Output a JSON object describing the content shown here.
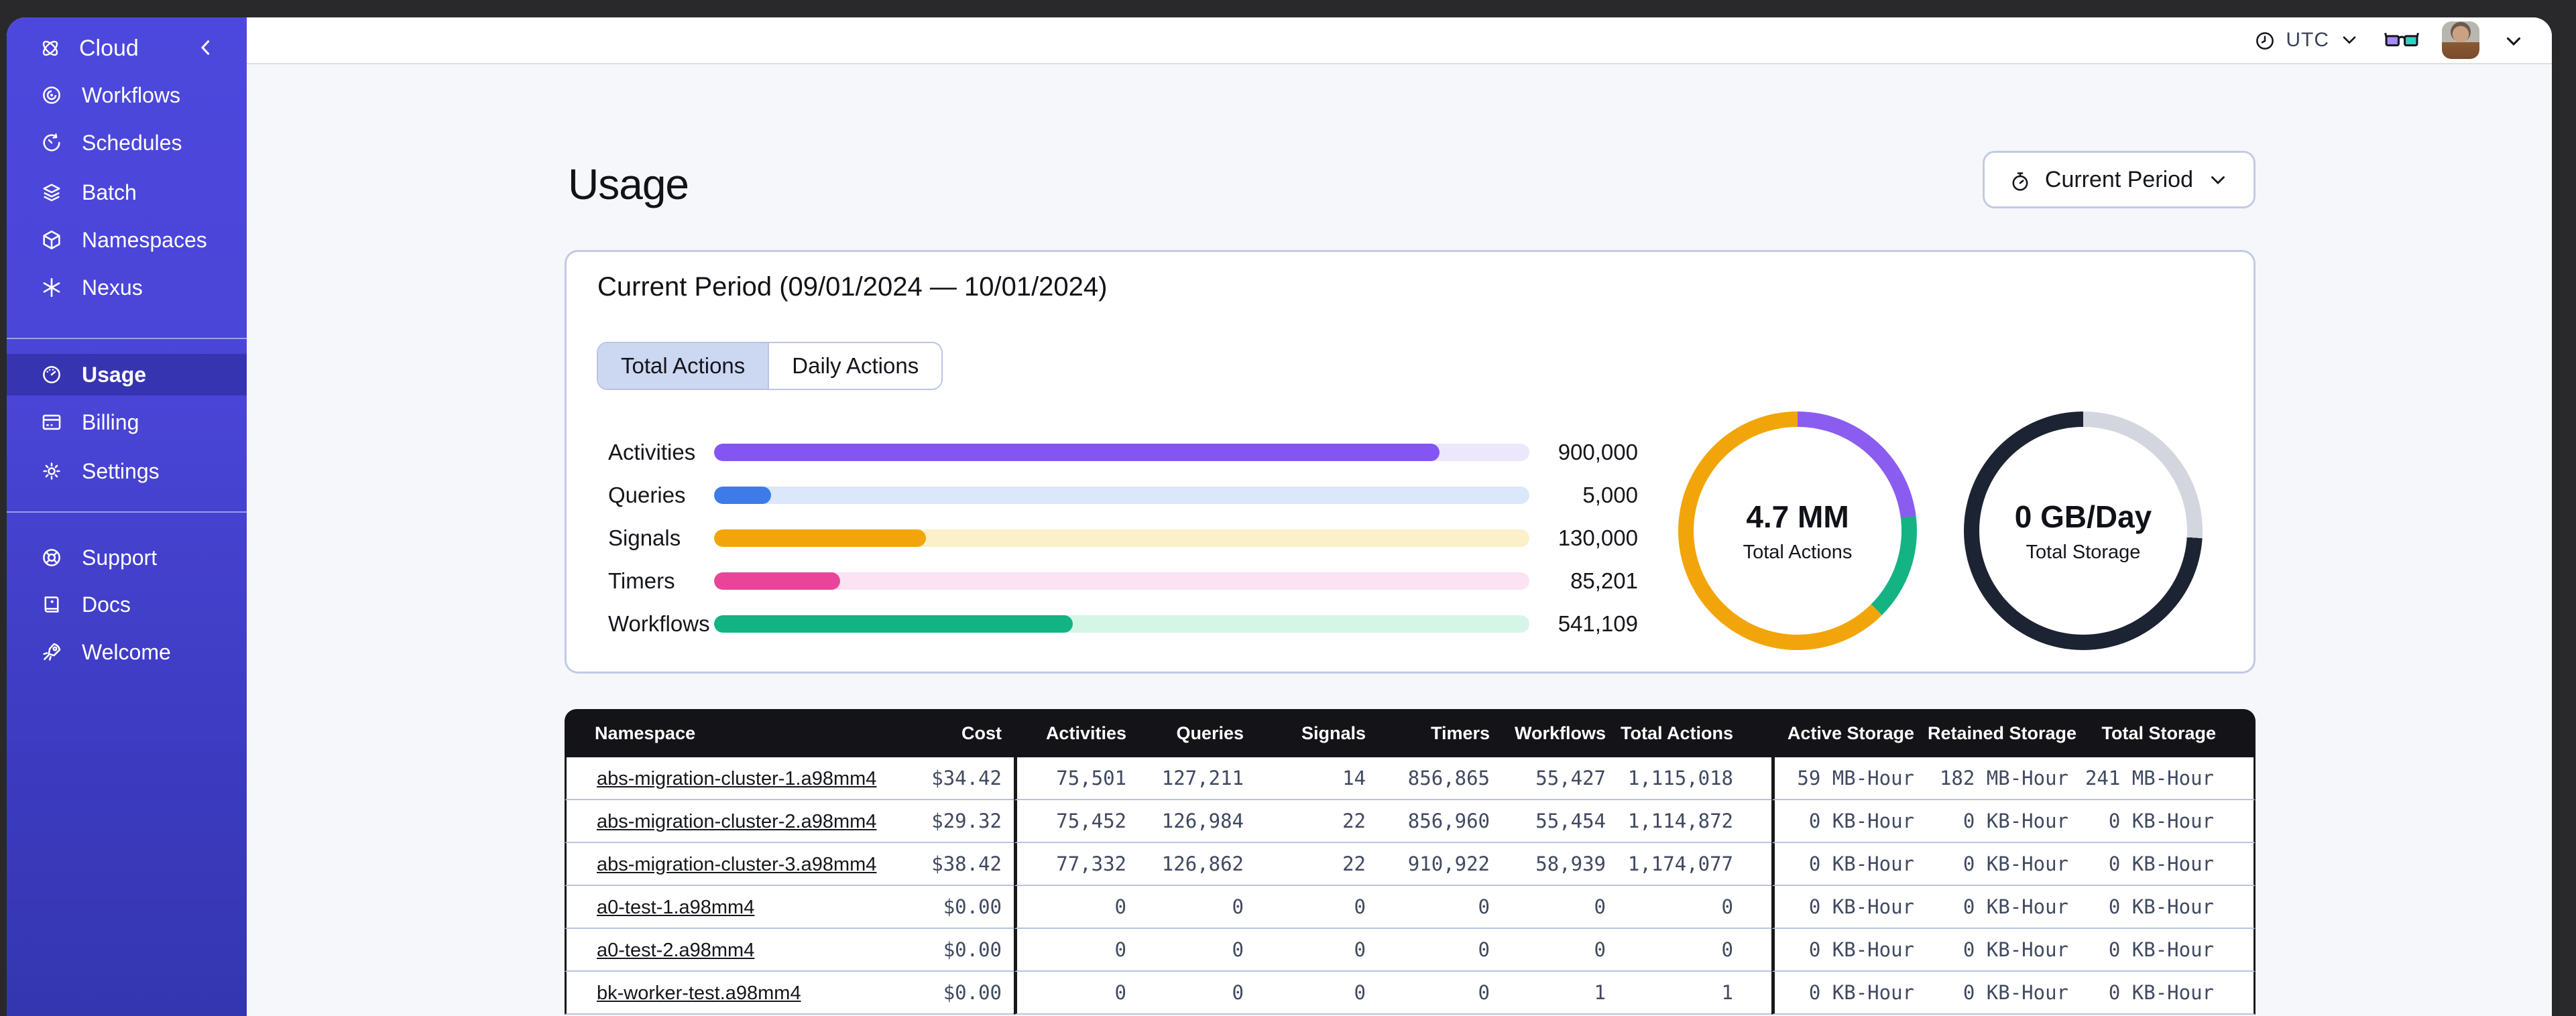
{
  "sidebar": {
    "brand": {
      "label": "Cloud"
    },
    "items_main": [
      {
        "label": "Workflows"
      },
      {
        "label": "Schedules"
      },
      {
        "label": "Batch"
      },
      {
        "label": "Namespaces"
      },
      {
        "label": "Nexus"
      }
    ],
    "items_account": [
      {
        "label": "Usage",
        "active": true
      },
      {
        "label": "Billing"
      },
      {
        "label": "Settings"
      }
    ],
    "items_help": [
      {
        "label": "Support"
      },
      {
        "label": "Docs"
      },
      {
        "label": "Welcome"
      }
    ]
  },
  "topbar": {
    "timezone": "UTC"
  },
  "page": {
    "title": "Usage",
    "period_button_label": "Current Period"
  },
  "usage_card": {
    "title": "Current Period (09/01/2024 — 10/01/2024)",
    "tabs": [
      {
        "label": "Total Actions",
        "active": true
      },
      {
        "label": "Daily Actions",
        "active": false
      }
    ]
  },
  "colors": {
    "sidebar_top": "#4d48dd",
    "sidebar_bottom": "#3436b0",
    "table_header_bg": "#141418",
    "row_divider": "#b9c3dd",
    "card_border": "#c2cbe4"
  },
  "chart_data": [
    {
      "type": "bar",
      "orientation": "horizontal",
      "title": "Total Actions by type (current period)",
      "categories": [
        "Activities",
        "Queries",
        "Signals",
        "Timers",
        "Workflows"
      ],
      "values": [
        900000,
        5000,
        130000,
        85201,
        541109
      ],
      "value_labels": [
        "900,000",
        "5,000",
        "130,000",
        "85,201",
        "541,109"
      ],
      "fill_pct": [
        89,
        7,
        26,
        15.5,
        44
      ],
      "colors": [
        "#8455f2",
        "#3d7ce8",
        "#f2a50a",
        "#e8459a",
        "#12b384"
      ],
      "track_colors": [
        "#ece7fb",
        "#dbe7fa",
        "#fcf0c8",
        "#fbe3f3",
        "#d5f6e6"
      ],
      "xlabel": "",
      "ylabel": "",
      "grid": false,
      "legend": "none"
    },
    {
      "type": "donut",
      "label": "4.7 MM",
      "sublabel": "Total Actions",
      "segments": [
        {
          "name": "activities",
          "color": "#8b5cf0",
          "pct": 23
        },
        {
          "name": "workflows",
          "color": "#14b384",
          "pct": 14.5
        },
        {
          "name": "signals-other",
          "color": "#f2a50a",
          "pct": 62.5
        }
      ]
    },
    {
      "type": "donut",
      "label": "0 GB/Day",
      "sublabel": "Total Storage",
      "segments": [
        {
          "name": "remaining",
          "color": "#d3d6de",
          "pct": 26
        },
        {
          "name": "used",
          "color": "#1c2433",
          "pct": 74
        }
      ]
    }
  ],
  "table": {
    "columns": [
      "Namespace",
      "Cost",
      "Activities",
      "Queries",
      "Signals",
      "Timers",
      "Workflows",
      "Total Actions",
      "Active Storage",
      "Retained Storage",
      "Total Storage"
    ],
    "rows": [
      {
        "namespace": "abs-migration-cluster-1.a98mm4",
        "cells": [
          "$34.42",
          "75,501",
          "127,211",
          "14",
          "856,865",
          "55,427",
          "1,115,018",
          "59 MB-Hour",
          "182 MB-Hour",
          "241 MB-Hour"
        ]
      },
      {
        "namespace": "abs-migration-cluster-2.a98mm4",
        "cells": [
          "$29.32",
          "75,452",
          "126,984",
          "22",
          "856,960",
          "55,454",
          "1,114,872",
          "0 KB-Hour",
          "0 KB-Hour",
          "0 KB-Hour"
        ]
      },
      {
        "namespace": "abs-migration-cluster-3.a98mm4",
        "cells": [
          "$38.42",
          "77,332",
          "126,862",
          "22",
          "910,922",
          "58,939",
          "1,174,077",
          "0 KB-Hour",
          "0 KB-Hour",
          "0 KB-Hour"
        ]
      },
      {
        "namespace": "a0-test-1.a98mm4",
        "cells": [
          "$0.00",
          "0",
          "0",
          "0",
          "0",
          "0",
          "0",
          "0 KB-Hour",
          "0 KB-Hour",
          "0 KB-Hour"
        ]
      },
      {
        "namespace": "a0-test-2.a98mm4",
        "cells": [
          "$0.00",
          "0",
          "0",
          "0",
          "0",
          "0",
          "0",
          "0 KB-Hour",
          "0 KB-Hour",
          "0 KB-Hour"
        ]
      },
      {
        "namespace": "bk-worker-test.a98mm4",
        "cells": [
          "$0.00",
          "0",
          "0",
          "0",
          "0",
          "0",
          "1",
          "1",
          "0 KB-Hour",
          "0 KB-Hour",
          "0 KB-Hour"
        ]
      }
    ]
  }
}
